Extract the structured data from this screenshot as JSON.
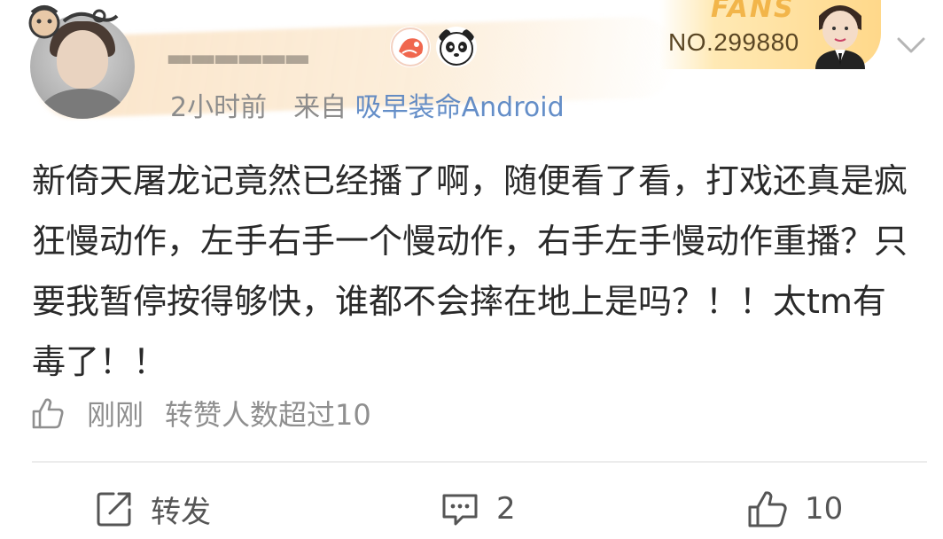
{
  "post": {
    "meta": {
      "time": "2小时前",
      "source_prefix": "来自",
      "source": "吸早装命Android"
    },
    "fans_badge": {
      "title": "FANS",
      "number": "NO.299880",
      "accent": "#f2b54a"
    },
    "content": "新倚天屠龙记竟然已经播了啊，随便看了看，打戏还真是疯狂慢动作，左手右手一个慢动作，右手左手慢动作重播？只要我暂停按得够快，谁都不会摔在地上是吗？！！太tm有毒了！！",
    "repost_note": {
      "time": "刚刚",
      "text": "转赞人数超过10"
    },
    "actions": {
      "repost_label": "转发",
      "comment_count": "2",
      "like_count": "10"
    },
    "icons": {
      "avatar": "avatar",
      "badge_1": "fish-badge-icon",
      "badge_2": "panda-badge-icon",
      "menu": "chevron-down-icon",
      "thumb": "thumb-up-icon",
      "repost": "share-icon",
      "comment": "comment-icon",
      "like": "like-icon"
    }
  }
}
